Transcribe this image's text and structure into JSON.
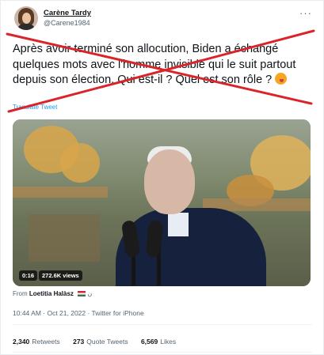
{
  "author": {
    "name": "Carène Tardy",
    "handle": "@Carene1984"
  },
  "tweet": {
    "text": "Après avoir terminé son allocution, Biden a échangé quelques mots avec l'homme invisible qui le suit partout depuis son élection. Qui est-il ? Quel est son rôle ?",
    "translate_label": "Translate Tweet"
  },
  "media": {
    "duration": "0:16",
    "views": "272.6K views"
  },
  "attribution": {
    "prefix": "From",
    "source": "Loetitia Halàsz",
    "suffix": "ن"
  },
  "meta": {
    "timestamp": "10:44 AM · Oct 21, 2022 · Twitter for iPhone"
  },
  "stats": {
    "retweets_count": "2,340",
    "retweets_label": "Retweets",
    "quotes_count": "273",
    "quotes_label": "Quote Tweets",
    "likes_count": "6,569",
    "likes_label": "Likes"
  },
  "colors": {
    "cross": "#d9252a",
    "link": "#1d9bf0",
    "secondary_text": "#536471"
  },
  "icons": [
    "more-options-icon",
    "flag-icon",
    "emoji-icon"
  ]
}
